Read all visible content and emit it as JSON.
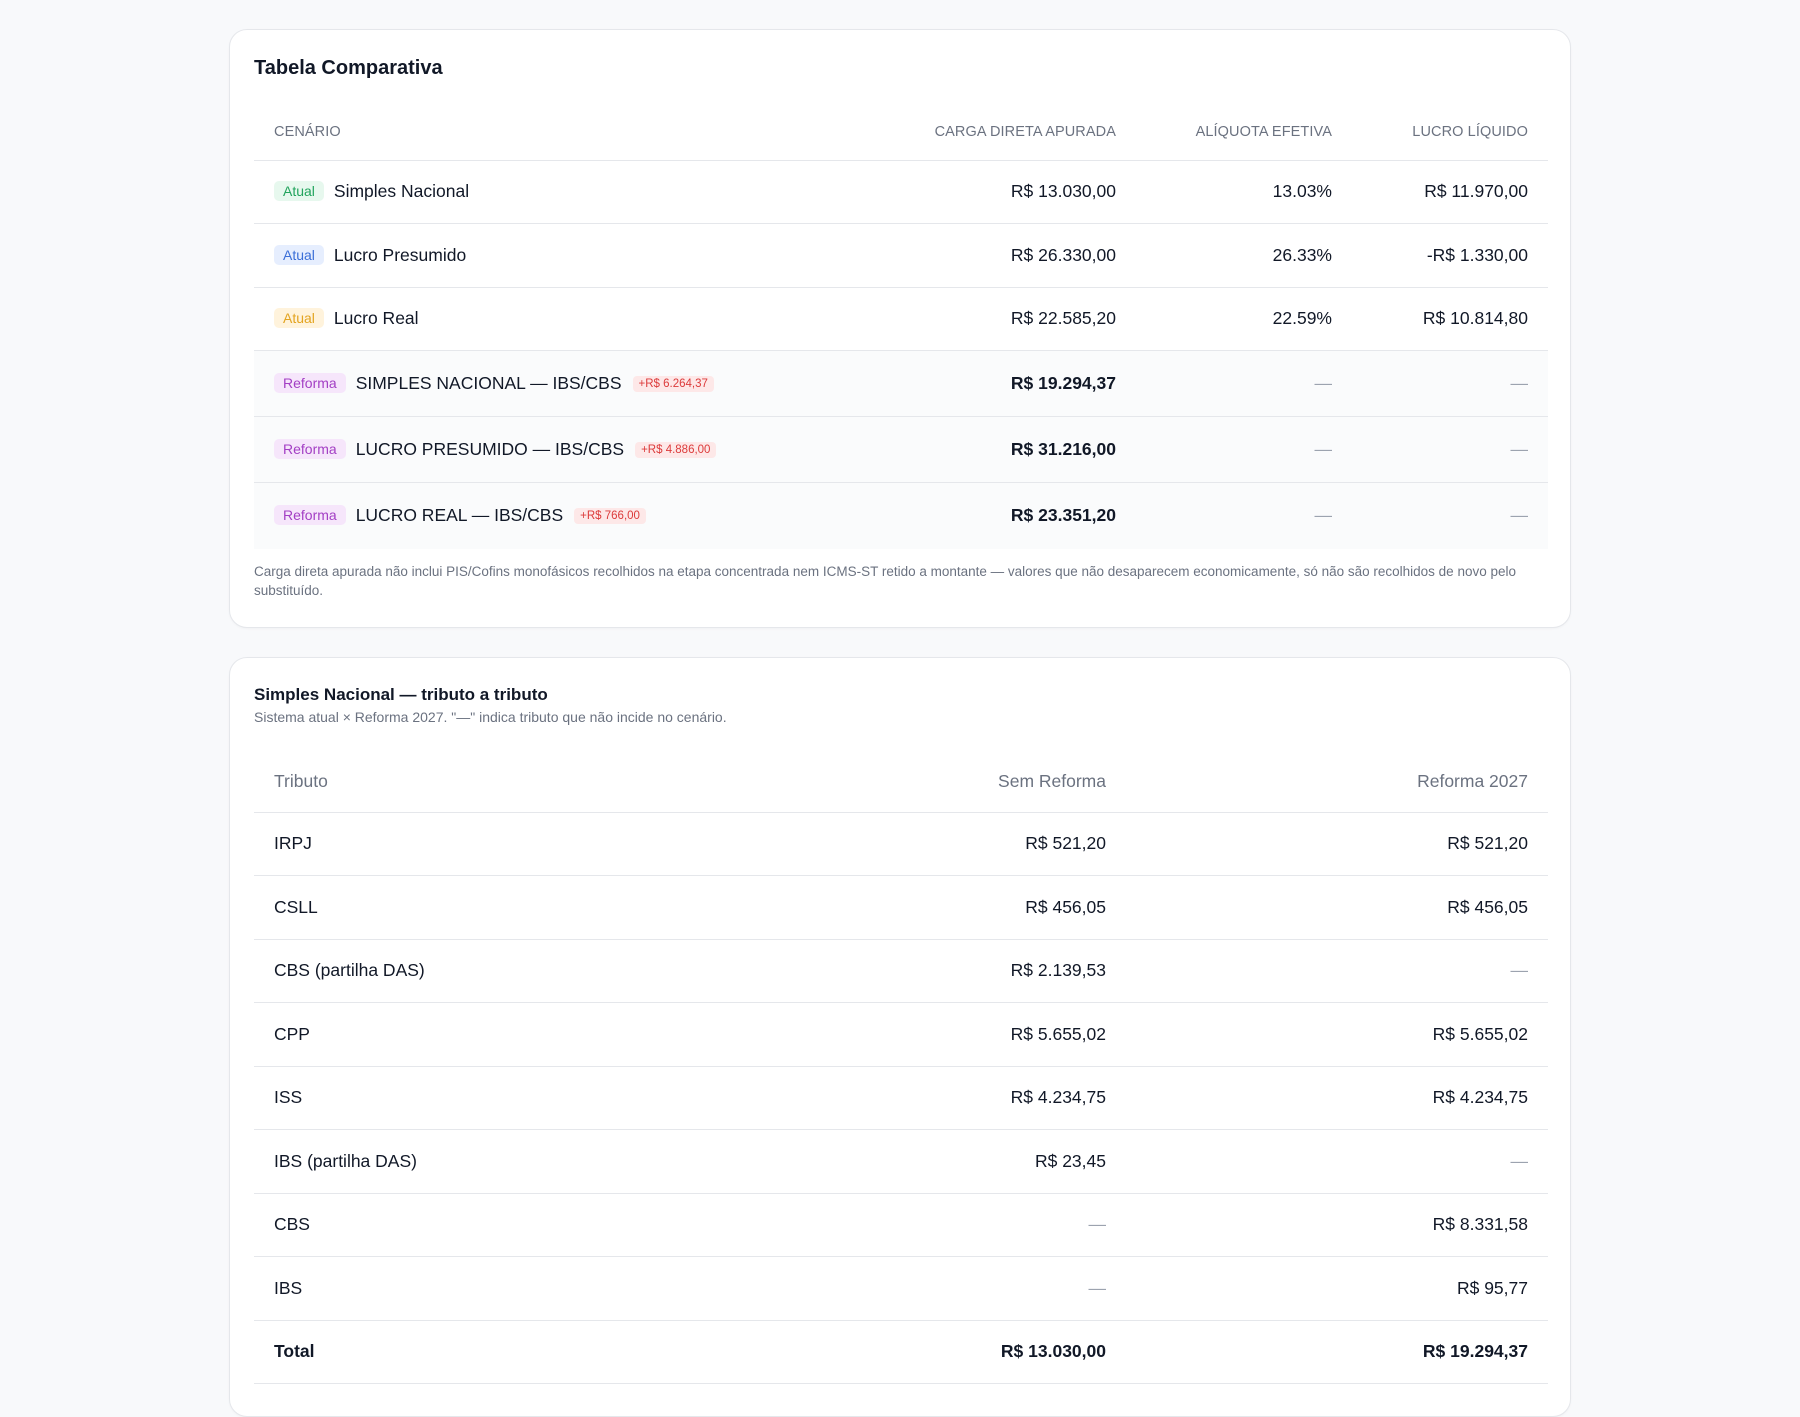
{
  "comparison": {
    "title": "Tabela Comparativa",
    "columns": [
      "CENÁRIO",
      "CARGA DIRETA APURADA",
      "ALÍQUOTA EFETIVA",
      "LUCRO LÍQUIDO"
    ],
    "rows": [
      {
        "badge": "Atual",
        "scenario": "Simples Nacional",
        "delta": "",
        "load": "R$ 13.030,00",
        "rate": "13.03%",
        "profit": "R$ 11.970,00"
      },
      {
        "badge": "Atual",
        "scenario": "Lucro Presumido",
        "delta": "",
        "load": "R$ 26.330,00",
        "rate": "26.33%",
        "profit": "-R$ 1.330,00"
      },
      {
        "badge": "Atual",
        "scenario": "Lucro Real",
        "delta": "",
        "load": "R$ 22.585,20",
        "rate": "22.59%",
        "profit": "R$ 10.814,80"
      },
      {
        "badge": "Reforma",
        "scenario": "SIMPLES NACIONAL — IBS/CBS",
        "delta": "+R$ 6.264,37",
        "load": "R$ 19.294,37",
        "rate": "—",
        "profit": "—"
      },
      {
        "badge": "Reforma",
        "scenario": "LUCRO PRESUMIDO — IBS/CBS",
        "delta": "+R$ 4.886,00",
        "load": "R$ 31.216,00",
        "rate": "—",
        "profit": "—"
      },
      {
        "badge": "Reforma",
        "scenario": "LUCRO REAL — IBS/CBS",
        "delta": "+R$ 766,00",
        "load": "R$ 23.351,20",
        "rate": "—",
        "profit": "—"
      }
    ],
    "badge_colors": {
      "atual_simples": "#22a45d",
      "atual_presumido": "#3b6fd8",
      "atual_real": "#e3a421",
      "reforma": "#a33fc4",
      "delta": "#dc3b3b"
    },
    "footnote": "Carga direta apurada não inclui PIS/Cofins monofásicos recolhidos na etapa concentrada nem ICMS-ST retido a montante — valores que não desaparecem economicamente, só não são recolhidos de novo pelo substituído."
  },
  "breakdown": {
    "title": "Simples Nacional — tributo a tributo",
    "subtitle": "Sistema atual × Reforma 2027. \"—\" indica tributo que não incide no cenário.",
    "columns": [
      "Tributo",
      "Sem Reforma",
      "Reforma 2027"
    ],
    "rows": [
      {
        "tax": "IRPJ",
        "current": "R$ 521,20",
        "reform": "R$ 521,20"
      },
      {
        "tax": "CSLL",
        "current": "R$ 456,05",
        "reform": "R$ 456,05"
      },
      {
        "tax": "CBS (partilha DAS)",
        "current": "R$ 2.139,53",
        "reform": "—"
      },
      {
        "tax": "CPP",
        "current": "R$ 5.655,02",
        "reform": "R$ 5.655,02"
      },
      {
        "tax": "ISS",
        "current": "R$ 4.234,75",
        "reform": "R$ 4.234,75"
      },
      {
        "tax": "IBS (partilha DAS)",
        "current": "R$ 23,45",
        "reform": "—"
      },
      {
        "tax": "CBS",
        "current": "—",
        "reform": "R$ 8.331,58"
      },
      {
        "tax": "IBS",
        "current": "—",
        "reform": "R$ 95,77"
      },
      {
        "tax": "Total",
        "current": "R$ 13.030,00",
        "reform": "R$ 19.294,37"
      }
    ]
  }
}
